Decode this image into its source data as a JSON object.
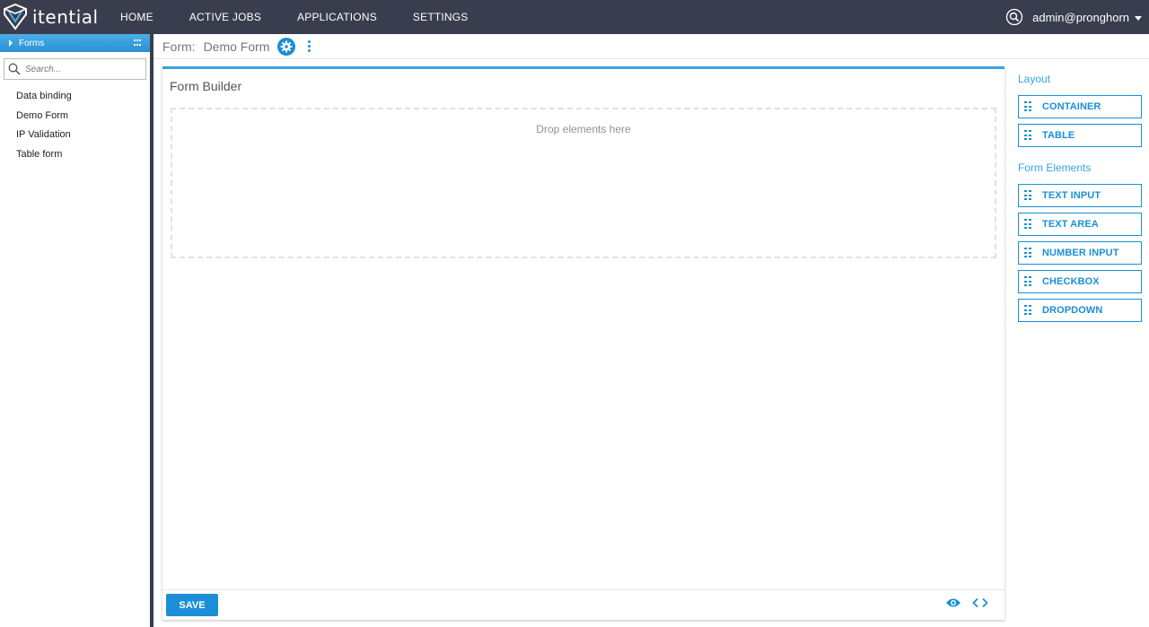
{
  "app": {
    "logo_text": "itential",
    "nav": [
      "HOME",
      "ACTIVE JOBS",
      "APPLICATIONS",
      "SETTINGS"
    ],
    "user": "admin@pronghorn"
  },
  "sidebar": {
    "section_label": "Forms",
    "search_placeholder": "Search...",
    "items": [
      "Data binding",
      "Demo Form",
      "IP Validation",
      "Table form"
    ]
  },
  "breadcrumb": {
    "prefix": "Form:",
    "name": "Demo Form"
  },
  "builder": {
    "title": "Form Builder",
    "drop_text": "Drop elements here",
    "save_label": "SAVE"
  },
  "palette": {
    "layout_heading": "Layout",
    "layout_items": [
      "CONTAINER",
      "TABLE"
    ],
    "elements_heading": "Form Elements",
    "element_items": [
      "TEXT INPUT",
      "TEXT AREA",
      "NUMBER INPUT",
      "CHECKBOX",
      "DROPDOWN"
    ]
  },
  "colors": {
    "nav_bg": "#3a3d4e",
    "accent": "#1a8fd6"
  }
}
